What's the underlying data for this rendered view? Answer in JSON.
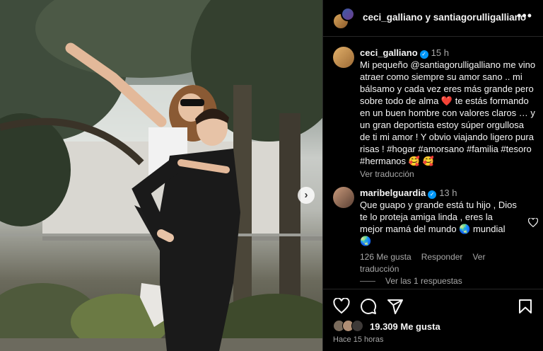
{
  "post": {
    "header_title": "ceci_galliano y santiagorulligalliano",
    "more_icon": "more-horizontal-icon"
  },
  "comments": [
    {
      "username": "ceci_galliano",
      "verified": true,
      "time": "15 h",
      "text": "Mi pequeño @santiagorulligalliano me vino atraer como siempre su amor sano .. mi bálsamo y cada vez eres más grande pero sobre todo de alma ❤️ te estás formando en un buen hombre con valores claros … y un gran deportista estoy súper orgullosa de ti mi amor ! Y obvio viajando ligero pura risas ! #hogar #amorsano #familia #tesoro #hermanos 🥰 🥰",
      "translate": "Ver traducción"
    },
    {
      "username": "maribelguardia",
      "verified": true,
      "time": "13 h",
      "text": "Que guapo y grande está tu hijo , Dios te lo proteja amiga linda , eres la mejor mamá del mundo 🌏 mundial 🌏",
      "likes": "126 Me gusta",
      "reply": "Responder",
      "translate": "Ver traducción",
      "view_replies": "Ver las 1 respuestas"
    }
  ],
  "actions": {
    "like_icon": "heart-icon",
    "comment_icon": "comment-icon",
    "share_icon": "share-icon",
    "save_icon": "bookmark-icon"
  },
  "likes_count": "19.309 Me gusta",
  "posted_ago": "Hace 15 horas",
  "colors": {
    "background": "#000000",
    "verified": "#0095f6",
    "heart": "#ed4956",
    "muted_text": "#a8a8a8"
  }
}
